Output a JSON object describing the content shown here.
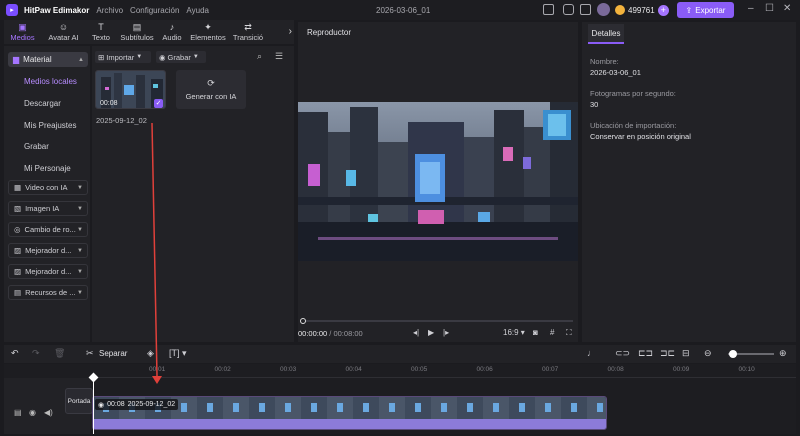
{
  "app": {
    "name": "HitPaw Edimakor",
    "menus": [
      "Archivo",
      "Configuración",
      "Ayuda"
    ],
    "document": "2026-03-06_01",
    "credits": "499761",
    "export_label": "Exportar",
    "accent": "#8a5cf6"
  },
  "top_tabs": [
    {
      "label": "Medios",
      "icon": "media-icon",
      "active": true
    },
    {
      "label": "Avatar AI",
      "icon": "avatar-icon"
    },
    {
      "label": "Texto",
      "icon": "text-icon"
    },
    {
      "label": "Subtítulos",
      "icon": "subtitles-icon"
    },
    {
      "label": "Audio",
      "icon": "audio-icon"
    },
    {
      "label": "Elementos",
      "icon": "elements-icon"
    },
    {
      "label": "Transició",
      "icon": "transition-icon"
    }
  ],
  "sidebar": {
    "header": "Material",
    "sub_items": [
      "Medios locales",
      "Descargar",
      "Mis Preajustes",
      "Grabar",
      "Mi Personaje"
    ],
    "active_sub": "Medios locales",
    "groups": [
      "Video con IA",
      "Imagen IA",
      "Cambio de ro...",
      "Mejorador d...",
      "Mejorador d...",
      "Recursos de ..."
    ]
  },
  "media": {
    "import_label": "Importar",
    "record_label": "Grabar",
    "clip_duration": "00:08",
    "clip_name": "2025-09-12_02",
    "generate_label": "Generar con IA"
  },
  "player": {
    "title": "Reproductor",
    "current_time": "00:00:00",
    "separator": " / ",
    "total_time": "00:08:00",
    "aspect": "16:9"
  },
  "details": {
    "tab": "Detalles",
    "fields": [
      {
        "label": "Nombre:",
        "value": "2026-03-06_01"
      },
      {
        "label": "Fotogramas por segundo:",
        "value": "30"
      },
      {
        "label": "Ubicación de importación:",
        "value": "Conservar en posición original"
      }
    ]
  },
  "timeline": {
    "split_label": "Separar",
    "ticks": [
      "00:01",
      "00:02",
      "00:03",
      "00:04",
      "00:05",
      "00:06",
      "00:07",
      "00:08",
      "00:09",
      "00:10",
      "00:11"
    ],
    "cover_label": "Portada",
    "clip_duration": "00:08",
    "clip_name": "2025-09-12_02",
    "zoom_level": 0.1
  }
}
